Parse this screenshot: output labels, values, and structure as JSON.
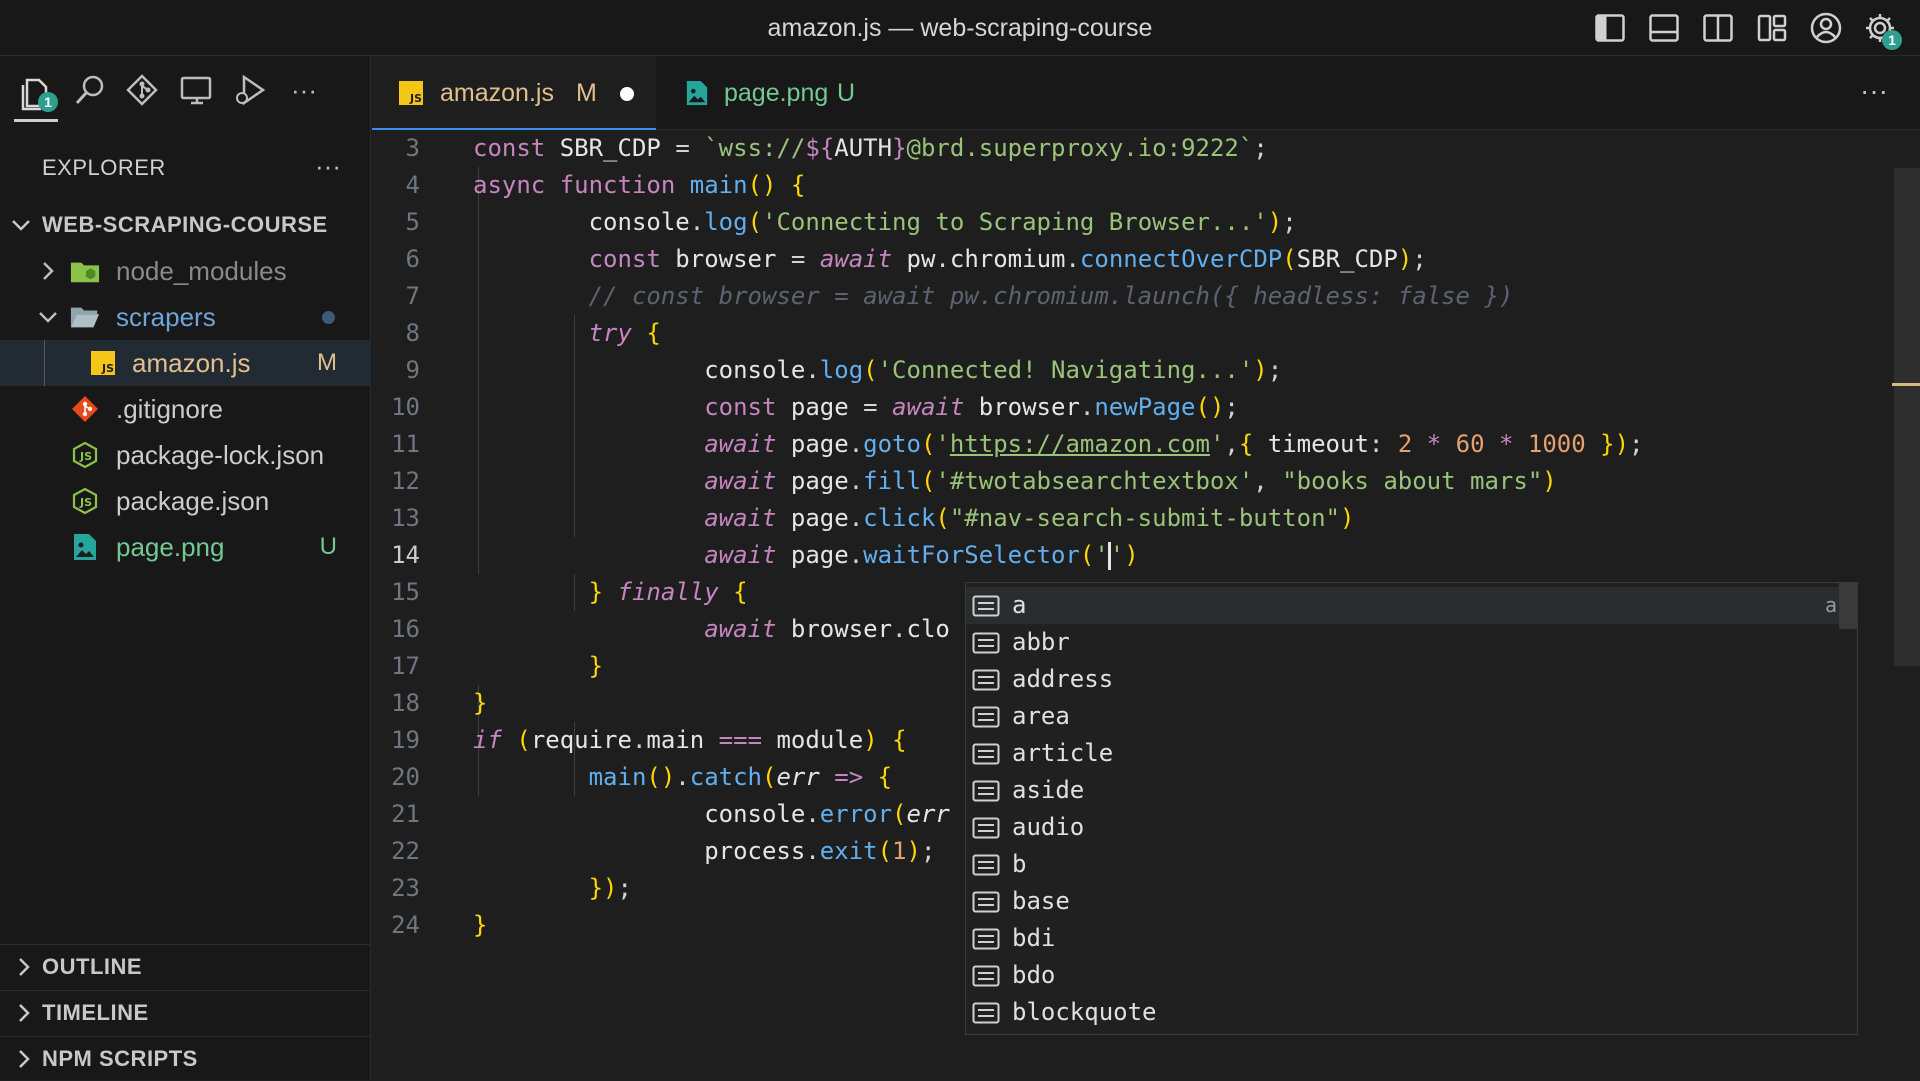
{
  "window": {
    "title": "amazon.js — web-scraping-course"
  },
  "titlebar_actions": {
    "icons": [
      "toggle-primary-sidebar-icon",
      "toggle-panel-icon",
      "toggle-secondary-sidebar-icon",
      "customize-layout-icon",
      "account-icon",
      "manage-gear-icon"
    ],
    "manage_badge": "1"
  },
  "activity_bar": {
    "items": [
      "explorer-icon",
      "search-icon",
      "source-control-icon",
      "remote-explorer-icon",
      "run-debug-icon"
    ],
    "explorer_badge": "1",
    "more": "···"
  },
  "explorer": {
    "title": "EXPLORER",
    "more": "···",
    "root": "WEB-SCRAPING-COURSE",
    "items": [
      {
        "label": "node_modules",
        "status": ""
      },
      {
        "label": "scrapers",
        "status": ""
      },
      {
        "label": "amazon.js",
        "status": "M"
      },
      {
        "label": ".gitignore",
        "status": ""
      },
      {
        "label": "package-lock.json",
        "status": ""
      },
      {
        "label": "package.json",
        "status": ""
      },
      {
        "label": "page.png",
        "status": "U"
      }
    ]
  },
  "panels": [
    {
      "label": "OUTLINE"
    },
    {
      "label": "TIMELINE"
    },
    {
      "label": "NPM SCRIPTS"
    }
  ],
  "tabs": [
    {
      "label": "amazon.js",
      "status": "M",
      "modified_dot": true,
      "active": true
    },
    {
      "label": "page.png",
      "status": "U",
      "active": false
    }
  ],
  "tab_more": "···",
  "editor": {
    "current_line": 14,
    "line_numbers": [
      "3",
      "4",
      "5",
      "6",
      "7",
      "8",
      "9",
      "10",
      "11",
      "12",
      "13",
      "14",
      "15",
      "16",
      "17",
      "18",
      "19",
      "20",
      "21",
      "22",
      "23",
      "24"
    ],
    "lines": [
      "const SBR_CDP = `wss://${AUTH}@brd.superproxy.io:9222`;",
      "async function main() {",
      "        console.log('Connecting to Scraping Browser...');",
      "        const browser = await pw.chromium.connectOverCDP(SBR_CDP);",
      "        // const browser = await pw.chromium.launch({ headless: false })",
      "        try {",
      "                console.log('Connected! Navigating...');",
      "                const page = await browser.newPage();",
      "                await page.goto('https://amazon.com',{ timeout: 2 * 60 * 1000 });",
      "                await page.fill('#twotabsearchtextbox', \"books about mars\")",
      "                await page.click(\"#nav-search-submit-button\")",
      "                await page.waitForSelector('')",
      "        } finally {",
      "                await browser.clo",
      "        }",
      "}",
      "if (require.main === module) {",
      "        main().catch(err => {",
      "                console.error(err",
      "                process.exit(1);",
      "        });",
      "}"
    ]
  },
  "suggestions": {
    "items": [
      "a",
      "abbr",
      "address",
      "area",
      "article",
      "aside",
      "audio",
      "b",
      "base",
      "bdi",
      "bdo",
      "blockquote"
    ],
    "focused_detail": "a"
  }
}
